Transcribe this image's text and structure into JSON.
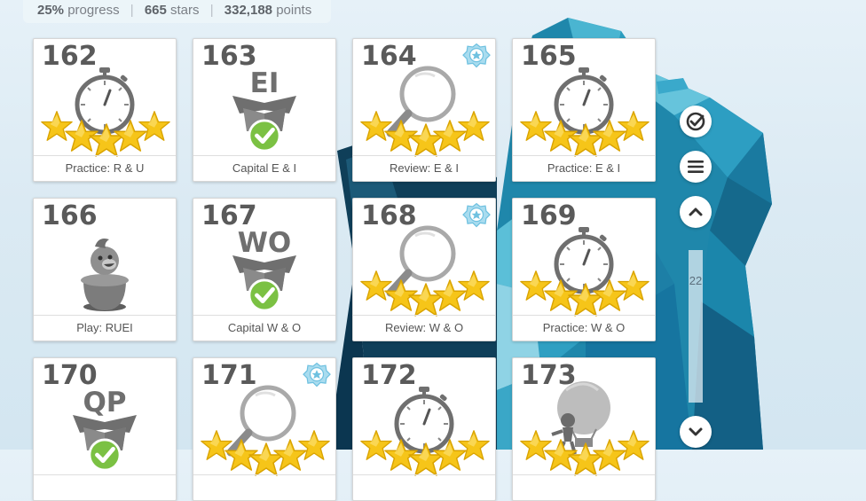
{
  "stats": {
    "progress_value": "25%",
    "progress_label": "progress",
    "stars_value": "665",
    "stars_label": "stars",
    "points_value": "332,188",
    "points_label": "points",
    "separator": "|"
  },
  "lessons": [
    {
      "number": "162",
      "label": "Practice: R & U",
      "icon": "stopwatch-icon",
      "stars": 5
    },
    {
      "number": "163",
      "label": "Capital E & I",
      "icon": "letter-box-icon",
      "box_text": "EI",
      "completed": true
    },
    {
      "number": "164",
      "label": "Review: E & I",
      "icon": "magnifier-icon",
      "stars": 5,
      "badge": "mastery-badge-icon"
    },
    {
      "number": "165",
      "label": "Practice: E & I",
      "icon": "stopwatch-icon",
      "stars": 5
    },
    {
      "number": "166",
      "label": "Play: RUEI",
      "icon": "character-in-pot-icon"
    },
    {
      "number": "167",
      "label": "Capital W & O",
      "icon": "letter-box-icon",
      "box_text": "WO",
      "completed": true
    },
    {
      "number": "168",
      "label": "Review: W & O",
      "icon": "magnifier-icon",
      "stars": 5,
      "badge": "mastery-badge-icon"
    },
    {
      "number": "169",
      "label": "Practice: W & O",
      "icon": "stopwatch-icon",
      "stars": 5
    },
    {
      "number": "170",
      "label": "",
      "icon": "letter-box-icon",
      "box_text": "QP",
      "completed": true
    },
    {
      "number": "171",
      "label": "",
      "icon": "magnifier-icon",
      "stars": 5,
      "badge": "mastery-badge-icon"
    },
    {
      "number": "172",
      "label": "",
      "icon": "stopwatch-icon",
      "stars": 5
    },
    {
      "number": "173",
      "label": "",
      "icon": "hot-air-balloon-icon",
      "stars": 5
    }
  ],
  "sidebar": {
    "page_number": "22",
    "buttons": [
      "check-circle-icon",
      "menu-icon",
      "chevron-up-icon",
      "chevron-down-icon"
    ]
  },
  "colors": {
    "star": "#f6c519",
    "star_outline": "#d9a300",
    "check": "#7bc143",
    "icon_gray": "#7a7a7a",
    "iceberg": "#1d8fb3"
  }
}
